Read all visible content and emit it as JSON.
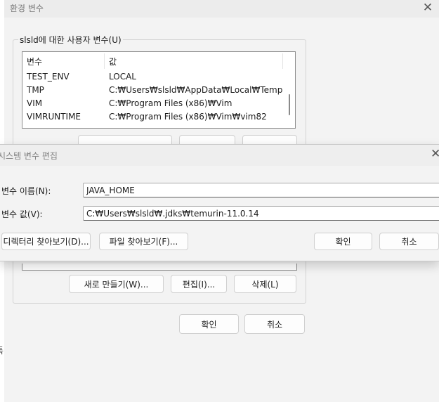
{
  "env_window": {
    "title": "환경 변수",
    "close_glyph": "✕",
    "user_group_label": "slsld에 대한 사용자 변수(U)",
    "columns": {
      "name": "변수",
      "value": "값"
    },
    "rows": [
      {
        "name": "TEST_ENV",
        "value": "LOCAL"
      },
      {
        "name": "TMP",
        "value": "C:₩Users₩slsld₩AppData₩Local₩Temp"
      },
      {
        "name": "VIM",
        "value": "C:₩Program Files (x86)₩Vim"
      },
      {
        "name": "VIMRUNTIME",
        "value": "C:₩Program Files (x86)₩Vim₩vim82"
      }
    ],
    "buttons": {
      "new": "새로 만들기(W)...",
      "edit": "편집(I)...",
      "delete": "삭제(L)"
    },
    "ok": "확인",
    "cancel": "취소",
    "left_edge_marks": "특"
  },
  "edit_dialog": {
    "title": "시스템 변수 편집",
    "close_glyph": "✕",
    "name_label": "변수 이름(N):",
    "name_value": "JAVA_HOME",
    "value_label": "변수 값(V):",
    "value_value": "C:₩Users₩slsld₩.jdks₩temurin-11.0.14",
    "browse_dir": "디렉터리 찾아보기(D)...",
    "browse_file": "파일 찾아보기(F)...",
    "ok": "확인",
    "cancel": "취소"
  }
}
